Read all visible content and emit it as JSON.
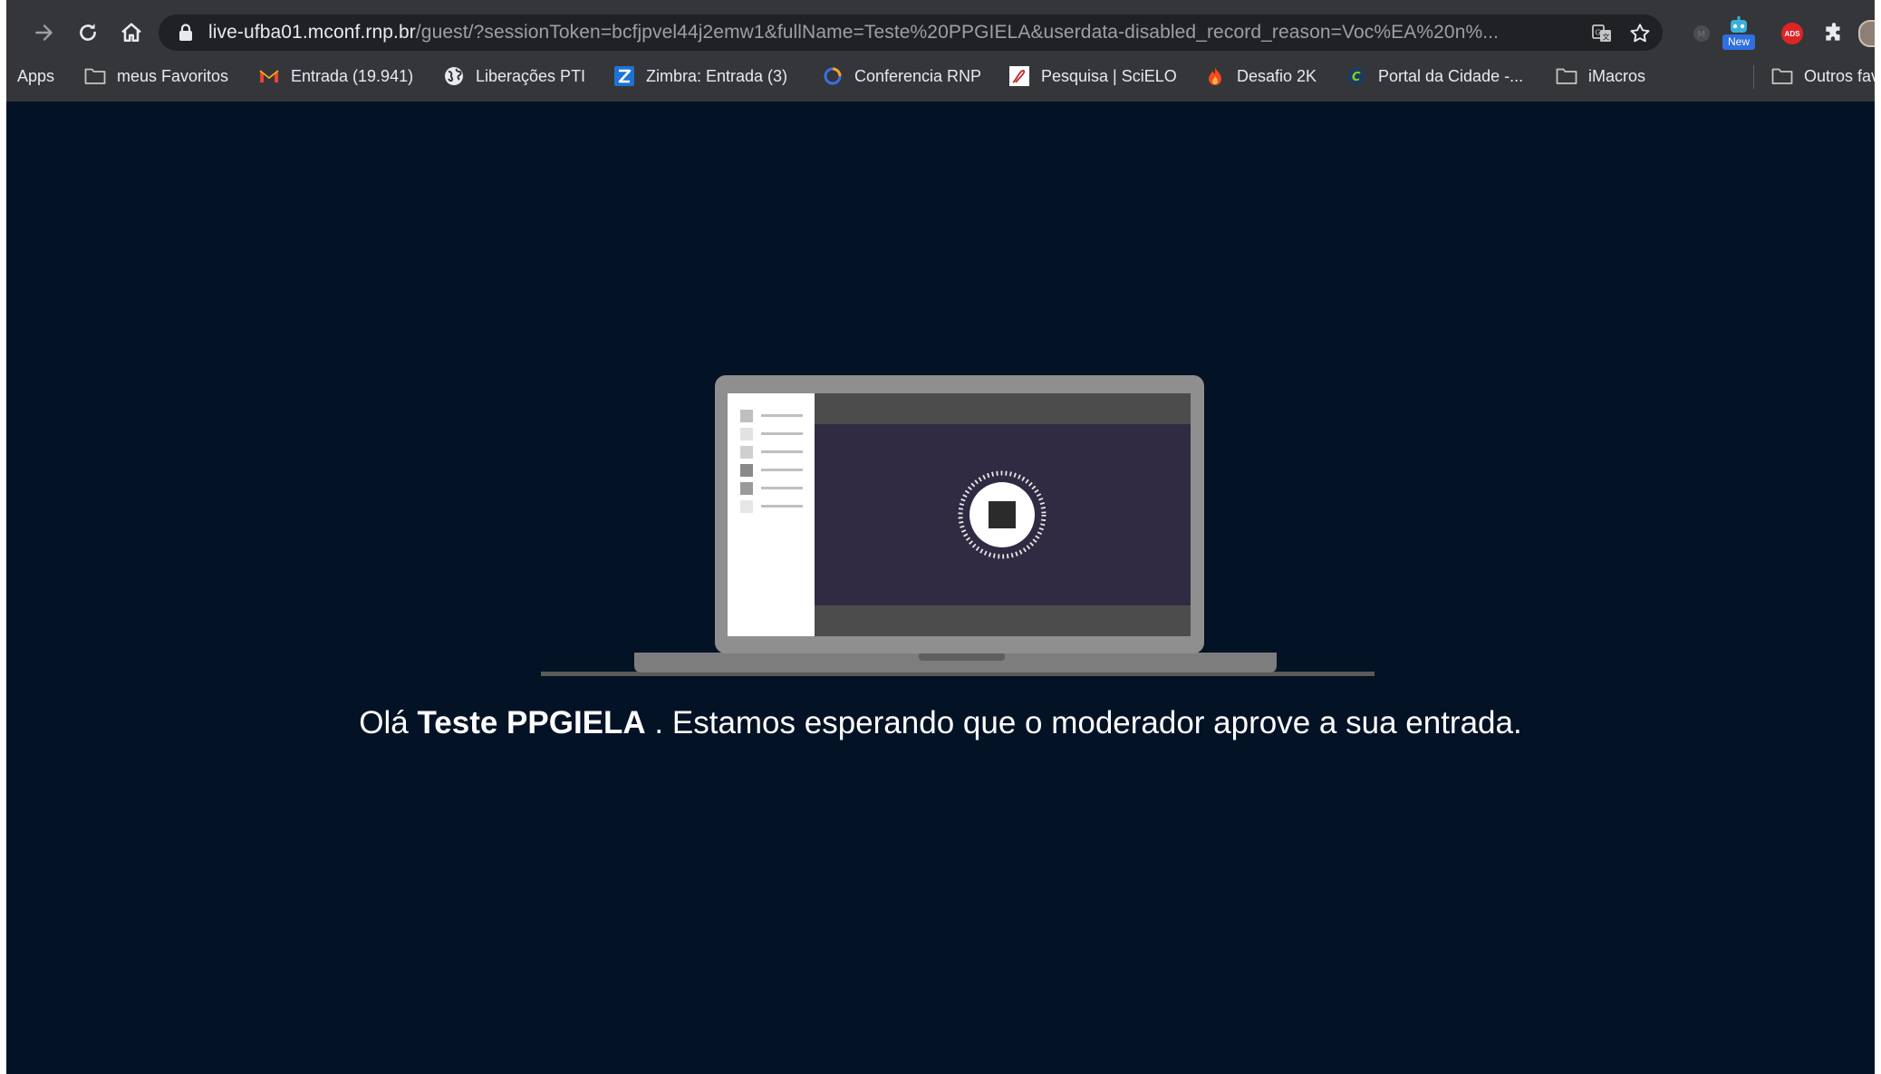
{
  "browser": {
    "url_host": "live-ufba01.mconf.rnp.br",
    "url_rest": "/guest/?sessionToken=bcfjpvel44j2emw1&fullName=Teste%20PPGIELA&userdata-disabled_record_reason=Voc%EA%20n%...",
    "extension_badge": "New",
    "extension_ads_label": "ADS"
  },
  "bookmarks": [
    {
      "label": "Apps",
      "icon": "apps-grid-icon"
    },
    {
      "label": "meus Favoritos",
      "icon": "folder-icon"
    },
    {
      "label": "Entrada (19.941)",
      "icon": "gmail-icon"
    },
    {
      "label": "Liberações PTI",
      "icon": "globe-icon"
    },
    {
      "label": "Zimbra: Entrada (3)",
      "icon": "zimbra-icon"
    },
    {
      "label": "Conferencia RNP",
      "icon": "rnp-icon"
    },
    {
      "label": "Pesquisa | SciELO",
      "icon": "scielo-icon"
    },
    {
      "label": "Desafio 2K",
      "icon": "flame-icon"
    },
    {
      "label": "Portal da Cidade -...",
      "icon": "portal-icon"
    },
    {
      "label": "iMacros",
      "icon": "folder-icon"
    },
    {
      "label": "Outros fav",
      "icon": "folder-icon"
    }
  ],
  "message": {
    "greeting": "Olá",
    "name": "Teste PPGIELA",
    "rest": ". Estamos esperando que o moderador aprove a sua entrada."
  },
  "colors": {
    "page_bg": "#041226",
    "chrome_bg": "#35363a",
    "omnibox_bg": "#202124",
    "text": "#ffffff"
  }
}
